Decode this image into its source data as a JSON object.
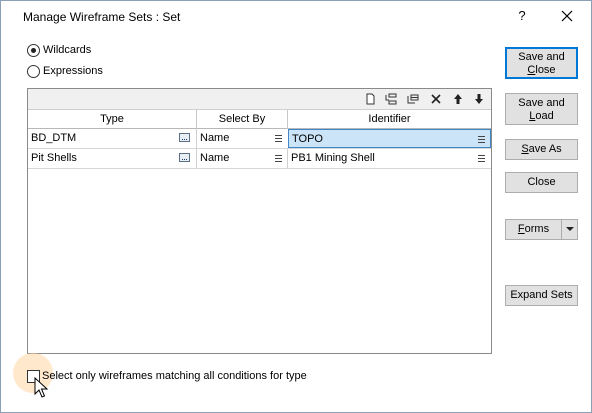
{
  "window": {
    "title": "Manage Wireframe Sets : Set",
    "help_label": "?"
  },
  "mode": {
    "options": [
      {
        "label": "Wildcards",
        "checked": true
      },
      {
        "label": "Expressions",
        "checked": false
      }
    ]
  },
  "grid": {
    "toolbar_icons": [
      "new-row-icon",
      "insert-row-icon",
      "append-row-icon",
      "delete-row-icon",
      "move-up-icon",
      "move-down-icon"
    ],
    "columns": [
      "Type",
      "Select By",
      "Identifier"
    ],
    "rows": [
      {
        "type": "BD_DTM",
        "select_by": "Name",
        "identifier": "TOPO",
        "selected": true
      },
      {
        "type": "Pit Shells",
        "select_by": "Name",
        "identifier": "PB1 Mining Shell",
        "selected": false
      }
    ]
  },
  "buttons": {
    "save_close": {
      "line1": "Save and",
      "line2_pre": "",
      "line2_u": "C",
      "line2_post": "lose"
    },
    "save_load": {
      "line1": "Save and",
      "line2_pre": "",
      "line2_u": "L",
      "line2_post": "oad"
    },
    "save_as": {
      "pre": "",
      "u": "S",
      "post": "ave As"
    },
    "close": {
      "label": "Close"
    },
    "forms": {
      "pre": "",
      "u": "F",
      "post": "orms"
    },
    "expand_sets": {
      "label": "Expand Sets"
    }
  },
  "filter": {
    "label": "Select only wireframes matching all conditions for type",
    "checked": false
  },
  "colors": {
    "selection_fill": "#cce4f7",
    "selection_border": "#3e86c7",
    "default_button_border": "#0078d7",
    "click_highlight": "#ffd6a0"
  }
}
